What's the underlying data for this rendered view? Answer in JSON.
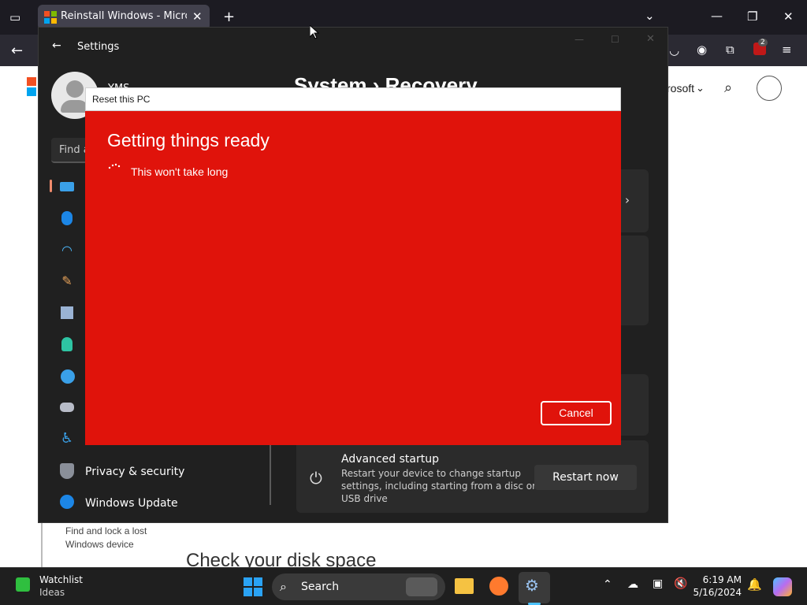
{
  "browser": {
    "tab_title": "Reinstall Windows - Microsoft S",
    "extension_badge": "2"
  },
  "page": {
    "brand_fragment": "rosoft",
    "breadcrumb_fragment": "covery",
    "sidebar_text": "Find and lock a lost Windows device",
    "heading_fragment": "Check your disk space"
  },
  "settings": {
    "title": "Settings",
    "user_fragment": "YMS",
    "search_placeholder": "Find a",
    "header": "System  ›  Recovery",
    "nav": {
      "privacy": "Privacy & security",
      "update": "Windows Update"
    },
    "advanced_startup": {
      "title": "Advanced startup",
      "description_1": "Restart your device to change startup",
      "description_2": "settings, including starting from a disc or",
      "description_3": "USB drive",
      "button": "Restart now"
    }
  },
  "dialog": {
    "window_title": "Reset this PC",
    "heading": "Getting things ready",
    "subtext": "This won't take long",
    "cancel_label": "Cancel"
  },
  "taskbar": {
    "widget_title": "Watchlist",
    "widget_sub": "Ideas",
    "search_label": "Search",
    "time": "6:19 AM",
    "date": "5/16/2024"
  }
}
